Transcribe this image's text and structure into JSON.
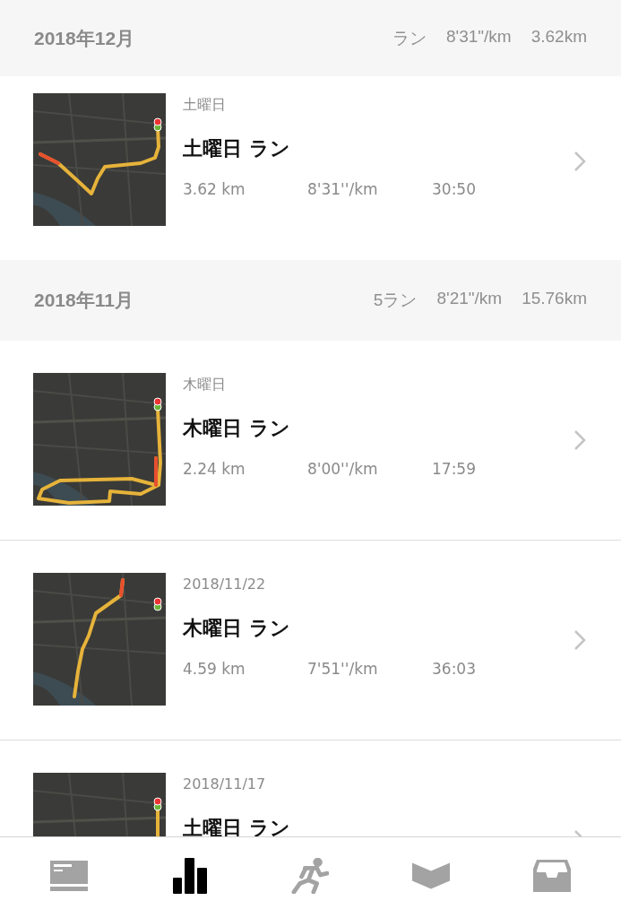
{
  "months": [
    {
      "title": "2018年12月",
      "summary": [
        "ラン",
        "8'31\"/km",
        "3.62km"
      ],
      "runs": [
        {
          "date": "土曜日",
          "title": "土曜日 ラン",
          "distance": "3.62 km",
          "pace": "8'31''/km",
          "time": "30:50"
        }
      ]
    },
    {
      "title": "2018年11月",
      "summary": [
        "5ラン",
        "8'21\"/km",
        "15.76km"
      ],
      "runs": [
        {
          "date": "木曜日",
          "title": "木曜日 ラン",
          "distance": "2.24 km",
          "pace": "8'00''/km",
          "time": "17:59"
        },
        {
          "date": "2018/11/22",
          "title": "木曜日 ラン",
          "distance": "4.59 km",
          "pace": "7'51''/km",
          "time": "36:03"
        },
        {
          "date": "2018/11/17",
          "title": "土曜日 ラン"
        }
      ]
    }
  ],
  "tabs": [
    {
      "kind": "feed",
      "selected": false
    },
    {
      "kind": "stats",
      "selected": true
    },
    {
      "kind": "run",
      "selected": false
    },
    {
      "kind": "ribbon",
      "selected": false
    },
    {
      "kind": "inbox",
      "selected": false
    }
  ]
}
